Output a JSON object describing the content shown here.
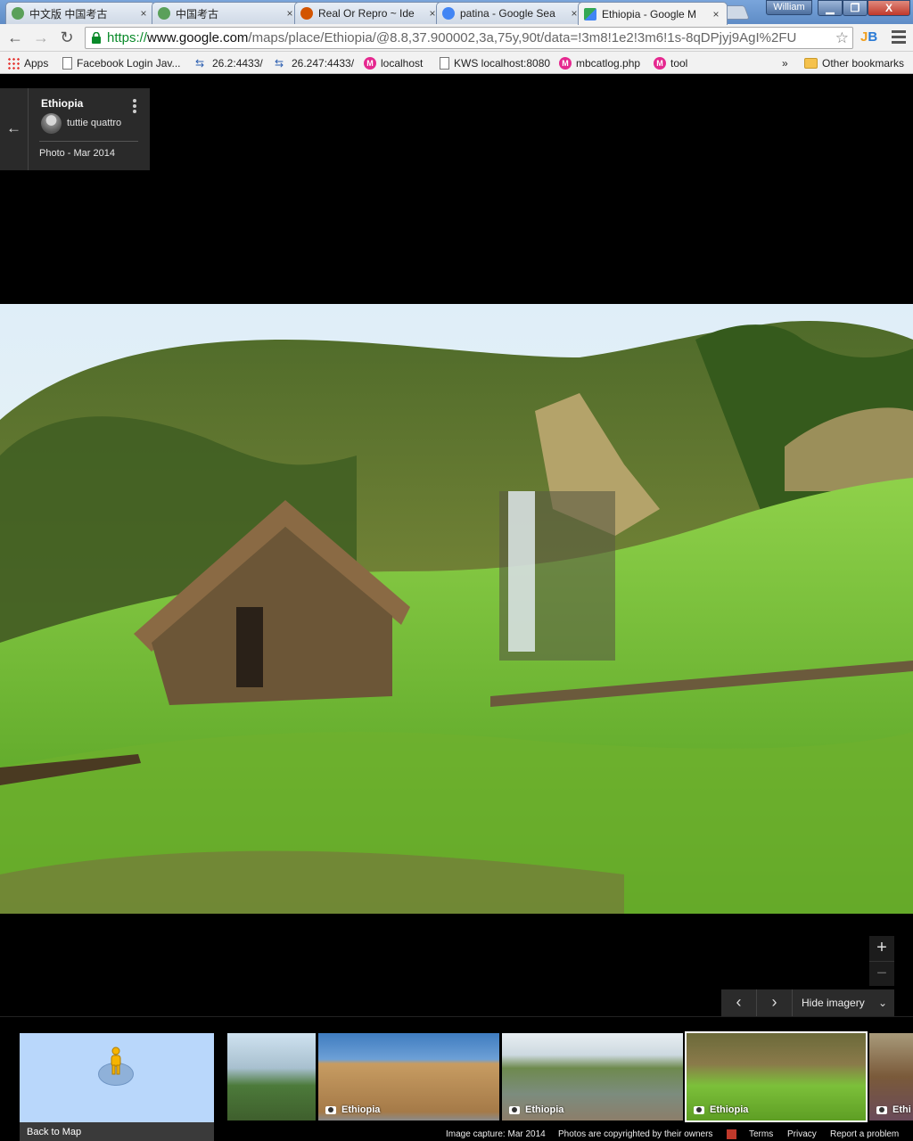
{
  "browser": {
    "tabs": [
      {
        "label": "中文版 中国考古",
        "icon_color": "#5aa05a"
      },
      {
        "label": "中国考古",
        "icon_color": "#5aa05a"
      },
      {
        "label": "Real Or Repro ~ Ide",
        "icon_color": "#d35400"
      },
      {
        "label": "patina - Google Sea",
        "icon_color": "#4285f4"
      },
      {
        "label": "Ethiopia - Google M",
        "icon_color": "#34a853",
        "active": true
      }
    ],
    "close_glyph": "×",
    "user": "William",
    "window_buttons": {
      "minimize": "▁",
      "maximize": "❐",
      "close": "X"
    }
  },
  "toolbar": {
    "back_glyph": "←",
    "forward_glyph": "→",
    "reload_glyph": "↻",
    "url_scheme": "https://",
    "url_host": "www.google.com",
    "url_path": "/maps/place/Ethiopia/@8.8,37.900002,3a,75y,90t/data=!3m8!1e2!3m6!1s-8qDPjyj9AgI%2FU",
    "star_glyph": "☆",
    "ext_label_a": "J",
    "ext_label_b": "B"
  },
  "bookmarks": [
    {
      "label": "Apps",
      "icon": "apps-grid-icon"
    },
    {
      "label": "Facebook Login Jav...",
      "icon": "page-icon"
    },
    {
      "label": "26.2:4433/",
      "icon": "network-icon"
    },
    {
      "label": "26.247:4433/",
      "icon": "network-icon"
    },
    {
      "label": "localhost",
      "icon": "m-badge-icon"
    },
    {
      "label": "KWS localhost:8080",
      "icon": "page-icon"
    },
    {
      "label": "mbcatlog.php",
      "icon": "m-badge-icon"
    },
    {
      "label": "tool",
      "icon": "m-badge-icon"
    }
  ],
  "bookmarks_overflow": "»",
  "other_bookmarks": "Other bookmarks",
  "m_badge_text": "M",
  "info": {
    "back_glyph": "←",
    "place": "Ethiopia",
    "author": "tuttie quattro",
    "meta": "Photo - Mar 2014"
  },
  "zoom": {
    "in": "+",
    "out": "−"
  },
  "nav": {
    "prev": "‹",
    "next": "›",
    "hide_imagery": "Hide imagery",
    "chevron": "⌄"
  },
  "filmstrip": {
    "back_to_map": "Back to Map",
    "thumbs": [
      {
        "label": ""
      },
      {
        "label": "Ethiopia"
      },
      {
        "label": "Ethiopia"
      },
      {
        "label": "Ethiopia",
        "selected": true
      },
      {
        "label": "Ethi"
      }
    ]
  },
  "footer": {
    "capture": "Image capture: Mar 2014",
    "copyright": "Photos are copyrighted by their owners",
    "terms": "Terms",
    "privacy": "Privacy",
    "report": "Report a problem"
  }
}
